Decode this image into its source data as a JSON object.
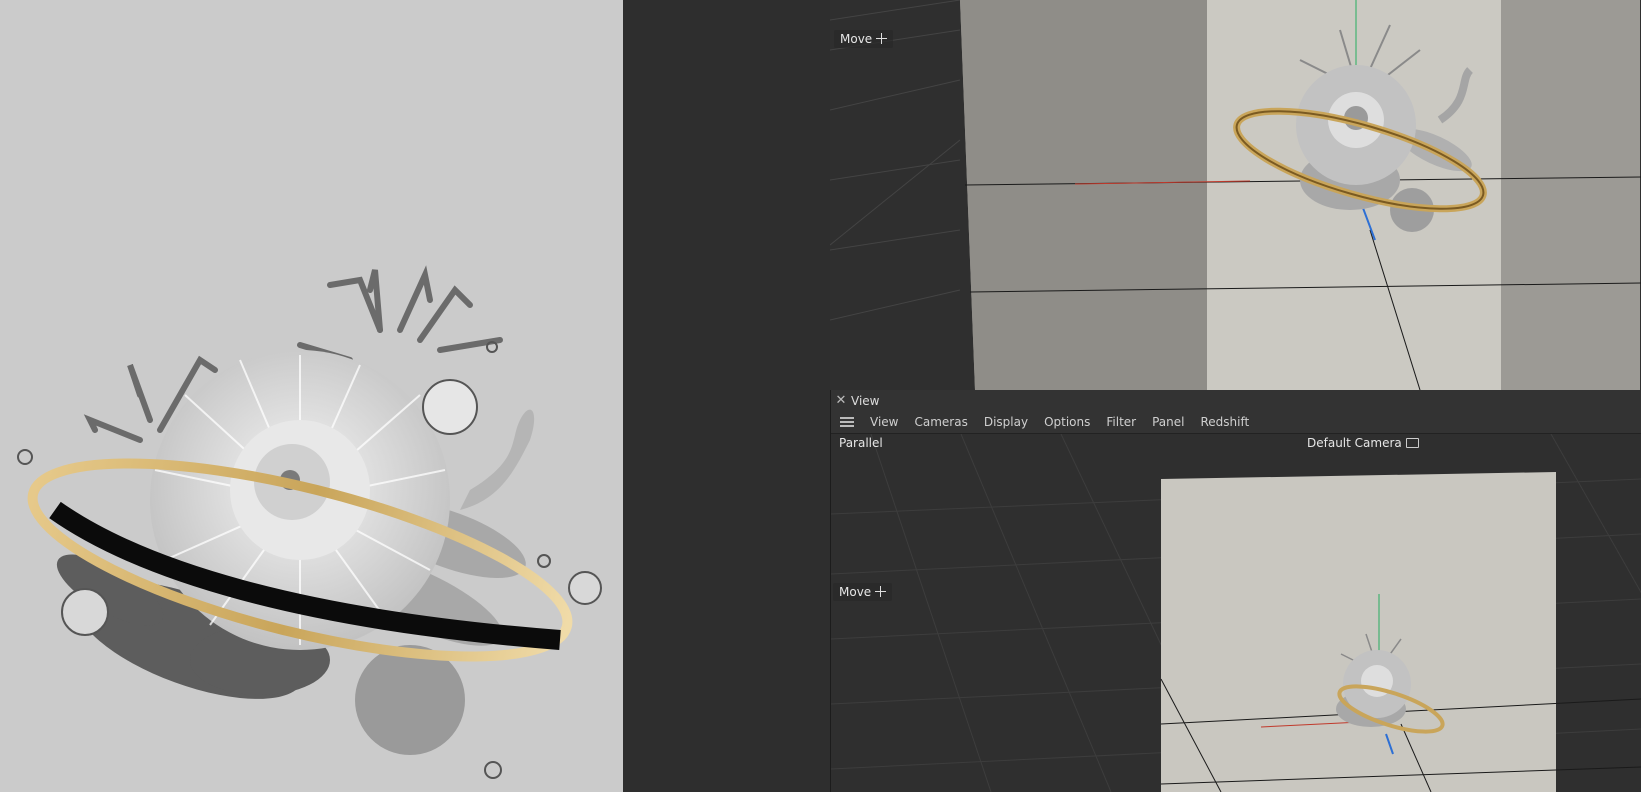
{
  "render_view": {},
  "top_viewport": {
    "tool_label": "Move"
  },
  "bottom_viewport": {
    "tab_title": "View",
    "menu": [
      "View",
      "Cameras",
      "Display",
      "Options",
      "Filter",
      "Panel",
      "Redshift"
    ],
    "projection_label": "Parallel",
    "camera_label": "Default Camera",
    "tool_label": "Move"
  },
  "colors": {
    "render_background": "#cbcbcb",
    "viewport_background": "#2f2f2f",
    "gold_ring": "#c9a55a",
    "x_axis": "#c0392b",
    "y_axis": "#27ae60",
    "z_axis": "#2d6fd4"
  },
  "icons": [
    "close-icon",
    "hamburger-menu-icon",
    "move-icon",
    "camera-icon"
  ]
}
